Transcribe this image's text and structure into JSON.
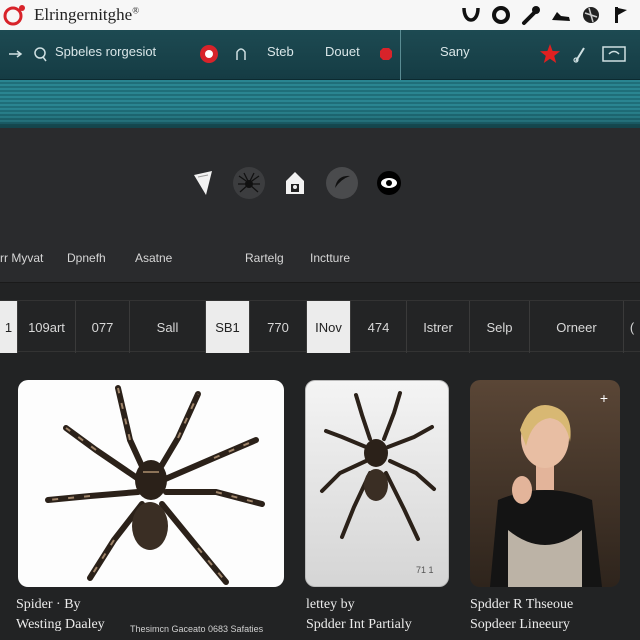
{
  "app": {
    "title": "Elringernitghe",
    "title_mark": "®"
  },
  "top_icons": [
    "horseshoe-icon",
    "ring-icon",
    "wrench-icon",
    "shoe-icon",
    "globe-icon",
    "flag-icon"
  ],
  "nav": {
    "items": [
      {
        "label": "Spbeles rorgesiot",
        "name": "nav-item-spbeles"
      },
      {
        "label": "Steb",
        "name": "nav-item-steb"
      },
      {
        "label": "Douet",
        "name": "nav-item-douet"
      },
      {
        "label": "Sany",
        "name": "nav-item-sany"
      }
    ]
  },
  "toolbar_icons": [
    "shield-icon",
    "spider-icon",
    "house-icon",
    "moon-icon",
    "eye-icon"
  ],
  "columns": [
    "rr Myvat",
    "Dpnefh",
    "Asatne",
    "Rartelg",
    "Inctture"
  ],
  "filters": [
    "1",
    "109art",
    "077",
    "Sall",
    "SB1",
    "770",
    "INov",
    "474",
    "Istrer",
    "Selp",
    "Orneer",
    "("
  ],
  "cards": [
    {
      "line1": "Spider · By",
      "line2": "Westing Daaley",
      "line3": "Thesimcn Gaceato 0683 Safaties"
    },
    {
      "line1": "lettey by",
      "line2": "Spdder Int Partialy",
      "badge": "71 1"
    },
    {
      "line1": "Spdder R Thseoue",
      "line2": "Sopdeer Lineeury"
    }
  ],
  "colors": {
    "nav_bg": "#1a4249",
    "banner": "#2a8591",
    "accent_red": "#d8232a"
  }
}
